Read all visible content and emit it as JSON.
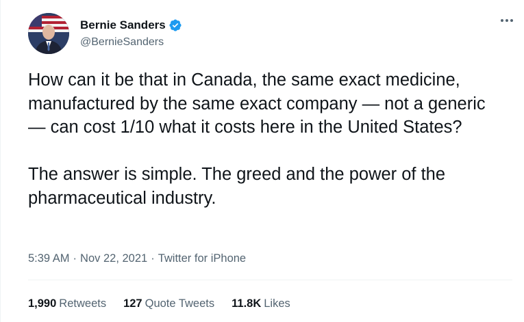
{
  "author": {
    "display_name": "Bernie Sanders",
    "handle": "@BernieSanders",
    "verified_icon": "verified-badge-icon"
  },
  "tweet": {
    "text": "How can it be that in Canada, the same exact medicine, manufactured by the same exact company — not a generic — can cost 1/10 what it costs here in the United States?\n\nThe answer is simple. The greed and the power of the pharmaceutical industry.",
    "time": "5:39 AM",
    "separator": "·",
    "date": "Nov 22, 2021",
    "source": "Twitter for iPhone"
  },
  "stats": [
    {
      "count": "1,990",
      "label": "Retweets"
    },
    {
      "count": "127",
      "label": "Quote Tweets"
    },
    {
      "count": "11.8K",
      "label": "Likes"
    }
  ],
  "colors": {
    "text": "#0f1419",
    "secondary": "#536471",
    "verified": "#1d9bf0",
    "divider": "#eff3f4"
  }
}
